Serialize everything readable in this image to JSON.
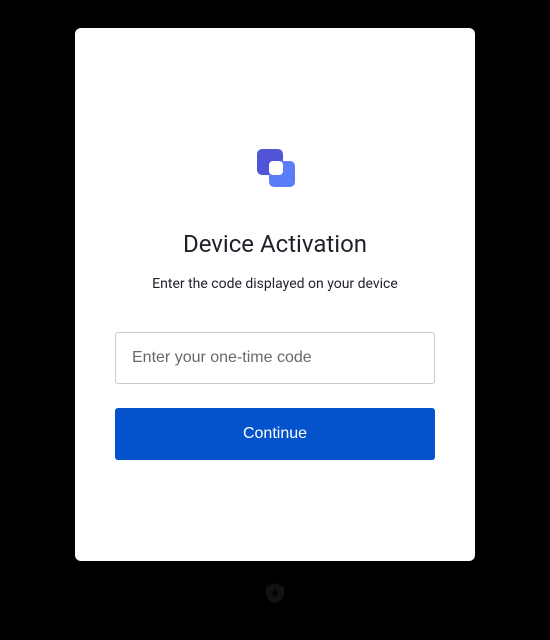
{
  "card": {
    "title": "Device Activation",
    "subtitle": "Enter the code displayed on your device",
    "input": {
      "placeholder": "Enter your one-time code",
      "value": ""
    },
    "button": {
      "label": "Continue"
    }
  },
  "colors": {
    "logo_primary": "#4F55D6",
    "logo_secondary": "#5C7CFA",
    "button_bg": "#0452cc"
  }
}
